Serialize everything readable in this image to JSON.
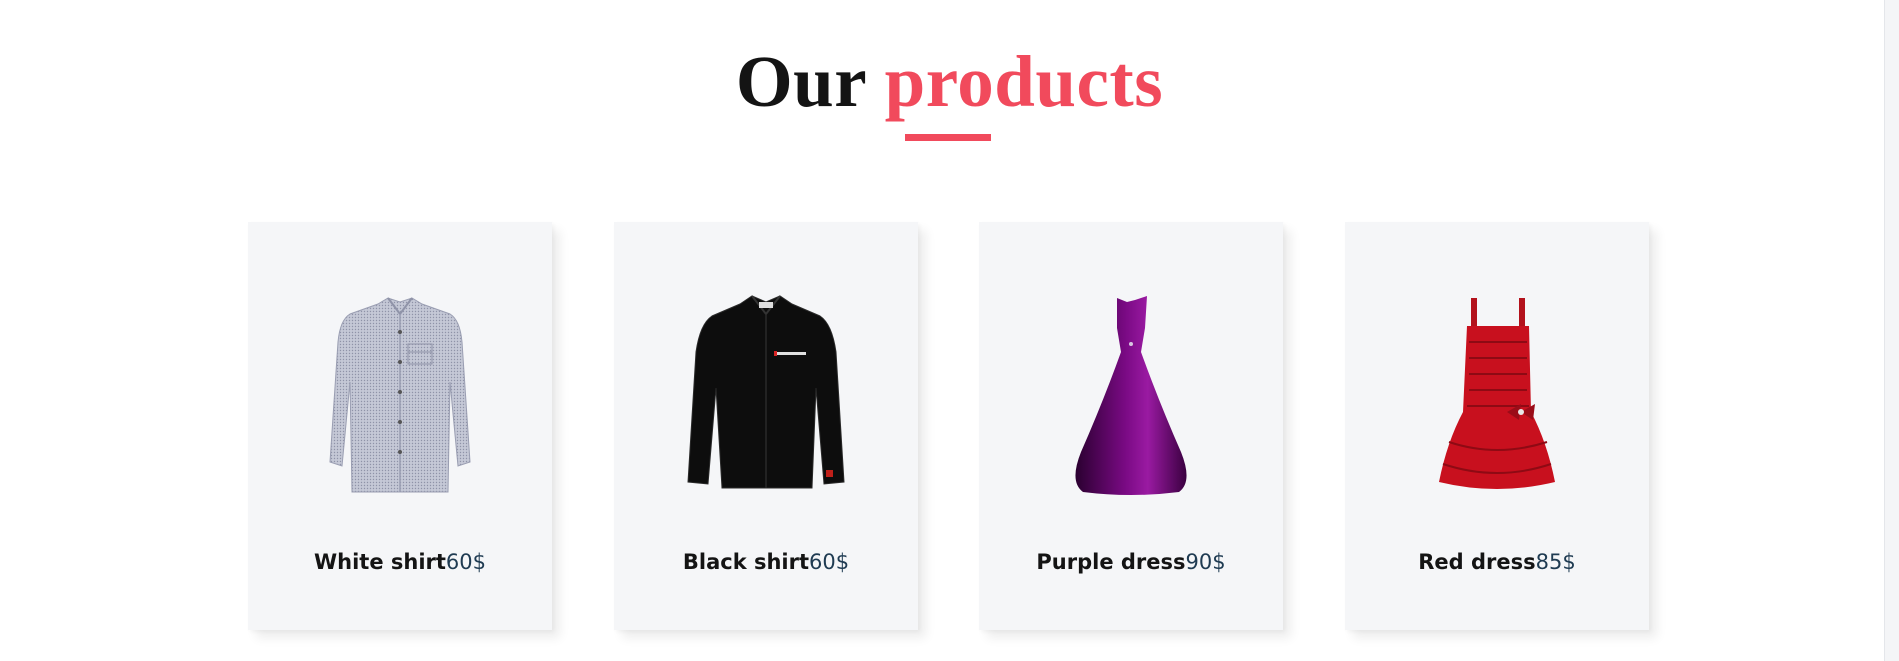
{
  "heading": {
    "word1": "Our",
    "word2": "products"
  },
  "colors": {
    "accent": "#f14a5c",
    "card_bg": "#f5f6f8",
    "price": "#1f3b52"
  },
  "products": [
    {
      "name": "White shirt",
      "price": "60$",
      "icon": "white-shirt-image"
    },
    {
      "name": "Black shirt",
      "price": "60$",
      "icon": "black-shirt-image"
    },
    {
      "name": "Purple dress",
      "price": "90$",
      "icon": "purple-dress-image"
    },
    {
      "name": "Red dress",
      "price": "85$",
      "icon": "red-dress-image"
    }
  ]
}
